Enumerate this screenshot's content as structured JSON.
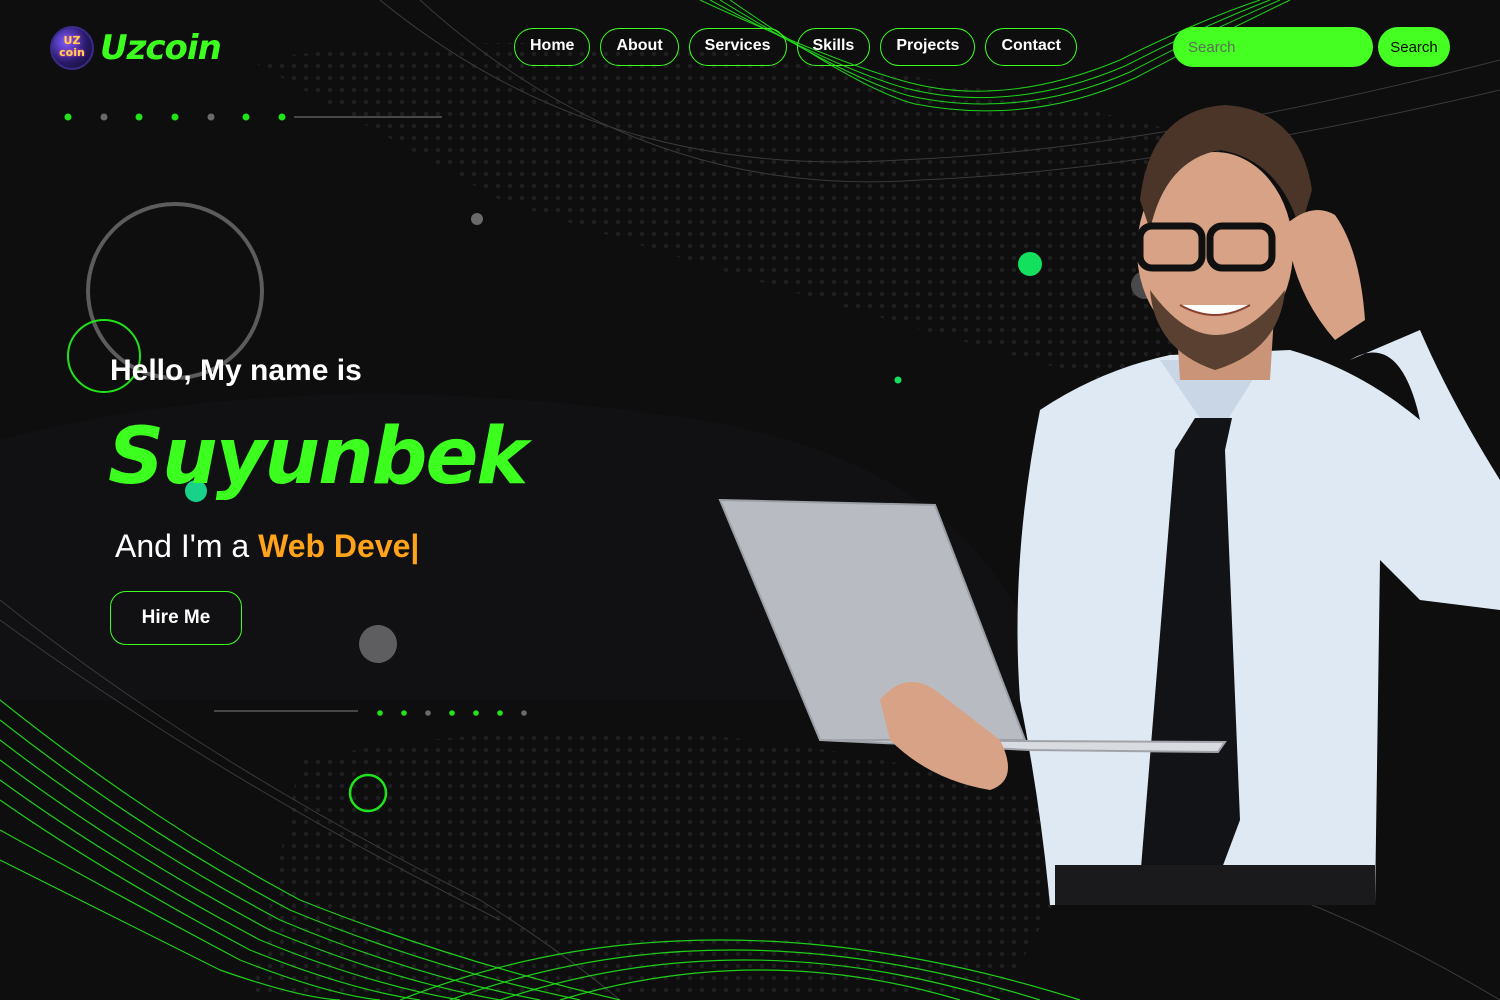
{
  "header": {
    "logo_badge_line1": "UZ",
    "logo_badge_line2": "coin",
    "logo_text": "Uzcoin",
    "nav": [
      {
        "label": "Home"
      },
      {
        "label": "About"
      },
      {
        "label": "Services"
      },
      {
        "label": "Skills"
      },
      {
        "label": "Projects"
      },
      {
        "label": "Contact"
      }
    ],
    "search": {
      "placeholder": "Search",
      "button_label": "Search"
    }
  },
  "hero": {
    "greeting": "Hello, My name is",
    "name": "Suyunbek",
    "role_prefix": "And I'm a ",
    "role_typed": "Web Deve",
    "cursor": "|",
    "hire_label": "Hire Me"
  },
  "colors": {
    "background": "#0e0e0f",
    "accent_green": "#3cff1f",
    "accent_orange": "#ffa31a"
  },
  "icons": {
    "logo": "uzcoin-badge-icon",
    "portrait": "person-with-laptop-illustration"
  }
}
